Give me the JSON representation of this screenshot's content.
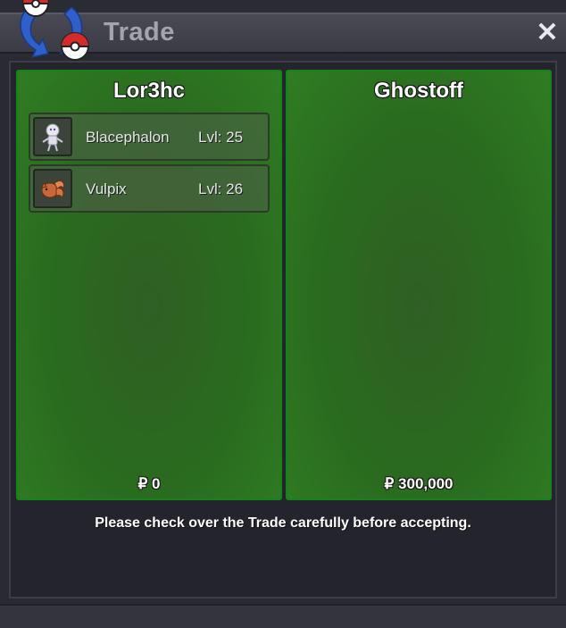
{
  "window": {
    "title": "Trade",
    "close_glyph": "✕"
  },
  "left_trader": {
    "name": "Lor3hc",
    "money": "₽ 0",
    "pokemon": [
      {
        "name": "Blacephalon",
        "level": "Lvl: 25",
        "icon": "blacephalon-sprite-icon"
      },
      {
        "name": "Vulpix",
        "level": "Lvl: 26",
        "icon": "vulpix-sprite-icon"
      }
    ]
  },
  "right_trader": {
    "name": "Ghostoff",
    "money": "₽ 300,000",
    "pokemon": []
  },
  "notice": "Please check over the Trade carefully before accepting.",
  "colors": {
    "panel_green": "#2a6b1f",
    "panel_border": "#16821a",
    "title_text": "#a4a4ac"
  }
}
